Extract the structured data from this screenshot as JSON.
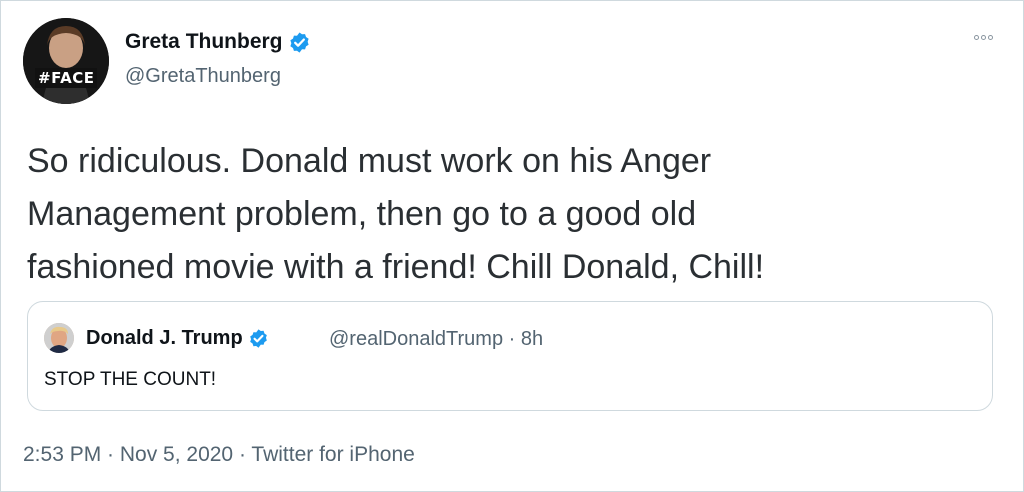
{
  "author": {
    "display_name": "Greta Thunberg",
    "handle": "@GretaThunberg",
    "avatar_badge": "#FACE",
    "verified": true
  },
  "tweet": {
    "text": "So ridiculous. Donald must work on his Anger\nManagement problem, then go to a good old\nfashioned movie with a friend! Chill Donald, Chill!"
  },
  "quoted_tweet": {
    "display_name": "Donald J. Trump",
    "meta": "@realDonaldTrump · 8h",
    "verified": true,
    "text": "STOP THE COUNT!"
  },
  "footer": {
    "meta": "2:53 PM · Nov 5, 2020 · Twitter for iPhone"
  },
  "colors": {
    "verified_blue": "#1d9bf0",
    "secondary_text": "#536471",
    "border": "#cfd9de"
  },
  "icons": {
    "more": "more-options-icon",
    "verified": "verified-badge-icon"
  }
}
